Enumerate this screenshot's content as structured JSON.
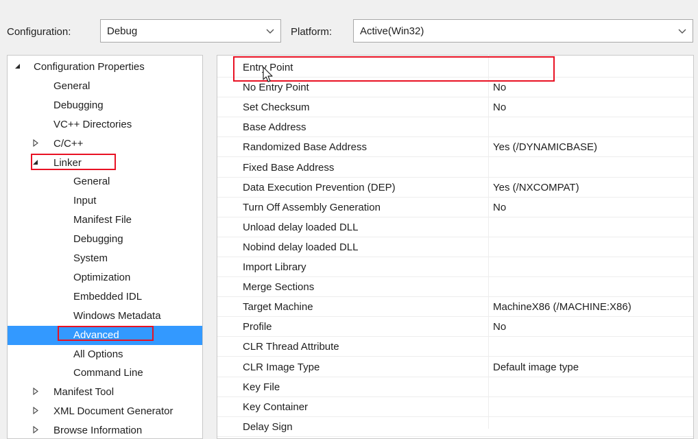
{
  "toolbar": {
    "configuration_label": "Configuration:",
    "configuration_value": "Debug",
    "platform_label": "Platform:",
    "platform_value": "Active(Win32)"
  },
  "tree": {
    "items": [
      {
        "label": "Configuration Properties",
        "expander": "expanded",
        "level": 0
      },
      {
        "label": "General",
        "expander": "none",
        "level": 1
      },
      {
        "label": "Debugging",
        "expander": "none",
        "level": 1
      },
      {
        "label": "VC++ Directories",
        "expander": "none",
        "level": 1
      },
      {
        "label": "C/C++",
        "expander": "collapsed",
        "level": 1
      },
      {
        "label": "Linker",
        "expander": "expanded",
        "level": 1
      },
      {
        "label": "General",
        "expander": "none",
        "level": 2
      },
      {
        "label": "Input",
        "expander": "none",
        "level": 2
      },
      {
        "label": "Manifest File",
        "expander": "none",
        "level": 2
      },
      {
        "label": "Debugging",
        "expander": "none",
        "level": 2
      },
      {
        "label": "System",
        "expander": "none",
        "level": 2
      },
      {
        "label": "Optimization",
        "expander": "none",
        "level": 2
      },
      {
        "label": "Embedded IDL",
        "expander": "none",
        "level": 2
      },
      {
        "label": "Windows Metadata",
        "expander": "none",
        "level": 2
      },
      {
        "label": "Advanced",
        "expander": "none",
        "level": 2,
        "selected": true
      },
      {
        "label": "All Options",
        "expander": "none",
        "level": 2
      },
      {
        "label": "Command Line",
        "expander": "none",
        "level": 2
      },
      {
        "label": "Manifest Tool",
        "expander": "collapsed",
        "level": 1
      },
      {
        "label": "XML Document Generator",
        "expander": "collapsed",
        "level": 1
      },
      {
        "label": "Browse Information",
        "expander": "collapsed",
        "level": 1
      }
    ]
  },
  "properties": [
    {
      "name": "Entry Point",
      "value": ""
    },
    {
      "name": "No Entry Point",
      "value": "No"
    },
    {
      "name": "Set Checksum",
      "value": "No"
    },
    {
      "name": "Base Address",
      "value": ""
    },
    {
      "name": "Randomized Base Address",
      "value": "Yes (/DYNAMICBASE)"
    },
    {
      "name": "Fixed Base Address",
      "value": ""
    },
    {
      "name": "Data Execution Prevention (DEP)",
      "value": "Yes (/NXCOMPAT)"
    },
    {
      "name": "Turn Off Assembly Generation",
      "value": "No"
    },
    {
      "name": "Unload delay loaded DLL",
      "value": ""
    },
    {
      "name": "Nobind delay loaded DLL",
      "value": ""
    },
    {
      "name": "Import Library",
      "value": ""
    },
    {
      "name": "Merge Sections",
      "value": ""
    },
    {
      "name": "Target Machine",
      "value": "MachineX86 (/MACHINE:X86)"
    },
    {
      "name": "Profile",
      "value": "No"
    },
    {
      "name": "CLR Thread Attribute",
      "value": ""
    },
    {
      "name": "CLR Image Type",
      "value": "Default image type"
    },
    {
      "name": "Key File",
      "value": ""
    },
    {
      "name": "Key Container",
      "value": ""
    },
    {
      "name": "Delay Sign",
      "value": ""
    }
  ],
  "icons": {
    "expanded": "triangle-expanded-icon",
    "collapsed": "triangle-collapsed-icon",
    "dropdown": "chevron-down-icon",
    "cursor": "mouse-cursor-icon"
  },
  "colors": {
    "selection": "#3399ff",
    "highlight_box": "#e81123"
  }
}
